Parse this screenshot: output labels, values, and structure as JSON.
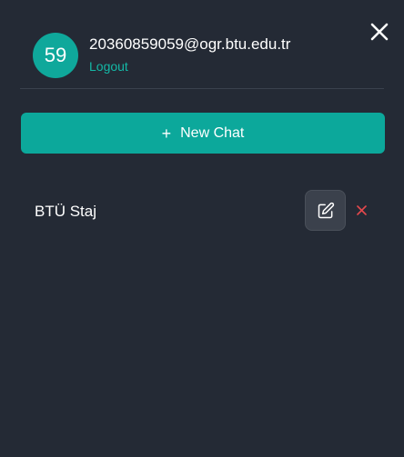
{
  "user": {
    "avatar_text": "59",
    "email": "20360859059@ogr.btu.edu.tr",
    "logout_label": "Logout"
  },
  "actions": {
    "new_chat_label": "New Chat",
    "plus_glyph": "+",
    "close_icon": "close-icon"
  },
  "chats": [
    {
      "title": "BTÜ Staj",
      "edit_icon": "edit-icon",
      "delete_icon": "delete-icon"
    }
  ],
  "colors": {
    "background": "#242a35",
    "accent": "#0ca89b",
    "link": "#14b8a6",
    "delete": "#e5484d",
    "edit_button": "#3b414c"
  }
}
